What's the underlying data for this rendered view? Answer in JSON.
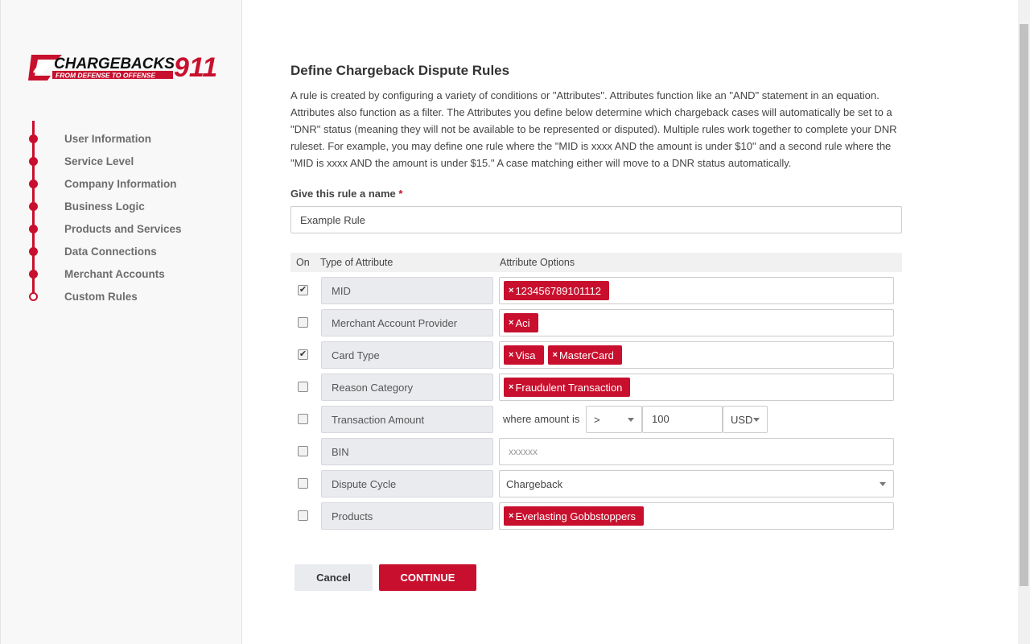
{
  "brand": {
    "name": "CHARGEBACKS",
    "number": "911",
    "tagline": "FROM DEFENSE TO OFFENSE",
    "accent": "#c8102e"
  },
  "sidebar": {
    "steps": [
      {
        "label": "User Information"
      },
      {
        "label": "Service Level"
      },
      {
        "label": "Company Information"
      },
      {
        "label": "Business Logic"
      },
      {
        "label": "Products and Services"
      },
      {
        "label": "Data Connections"
      },
      {
        "label": "Merchant Accounts"
      },
      {
        "label": "Custom Rules"
      }
    ]
  },
  "main": {
    "title": "Define Chargeback Dispute Rules",
    "description": "A rule is created by configuring a variety of conditions or \"Attributes\". Attributes function like an \"AND\" statement in an equation. Attributes also function as a filter. The Attributes you define below determine which chargeback cases will automatically be set to a \"DNR\" status (meaning they will not be available to be represented or disputed). Multiple rules work together to complete your DNR ruleset. For example, you may define one rule where the \"MID is xxxx AND the amount is under $10\" and a second rule where the \"MID is xxxx AND the amount is under $15.\" A case matching either will move to a DNR status automatically.",
    "name_label": "Give this rule a name",
    "required_mark": "*",
    "name_value": "Example Rule",
    "table": {
      "headers": {
        "on": "On",
        "type": "Type of Attribute",
        "options": "Attribute Options"
      },
      "rows": [
        {
          "type": "MID",
          "checked": "✔",
          "tags": [
            "123456789101112"
          ]
        },
        {
          "type": "Merchant Account Provider",
          "checked": "",
          "tags": [
            "Aci"
          ]
        },
        {
          "type": "Card Type",
          "checked": "✔",
          "tags": [
            "Visa",
            "MasterCard"
          ]
        },
        {
          "type": "Reason Category",
          "checked": "",
          "tags": [
            " Fraudulent Transaction"
          ]
        },
        {
          "type": "Transaction Amount",
          "checked": ""
        },
        {
          "type": "BIN",
          "checked": ""
        },
        {
          "type": "Dispute Cycle",
          "checked": ""
        },
        {
          "type": "Products",
          "checked": "",
          "tags": [
            "Everlasting Gobbstoppers"
          ]
        }
      ],
      "amount": {
        "prefix": "where amount is",
        "operator": ">",
        "value": "100",
        "currency": "USD"
      },
      "bin_placeholder": "xxxxxx",
      "dispute_cycle_value": "Chargeback",
      "tag_remove": "×"
    },
    "buttons": {
      "cancel": "Cancel",
      "continue": "CONTINUE"
    }
  }
}
